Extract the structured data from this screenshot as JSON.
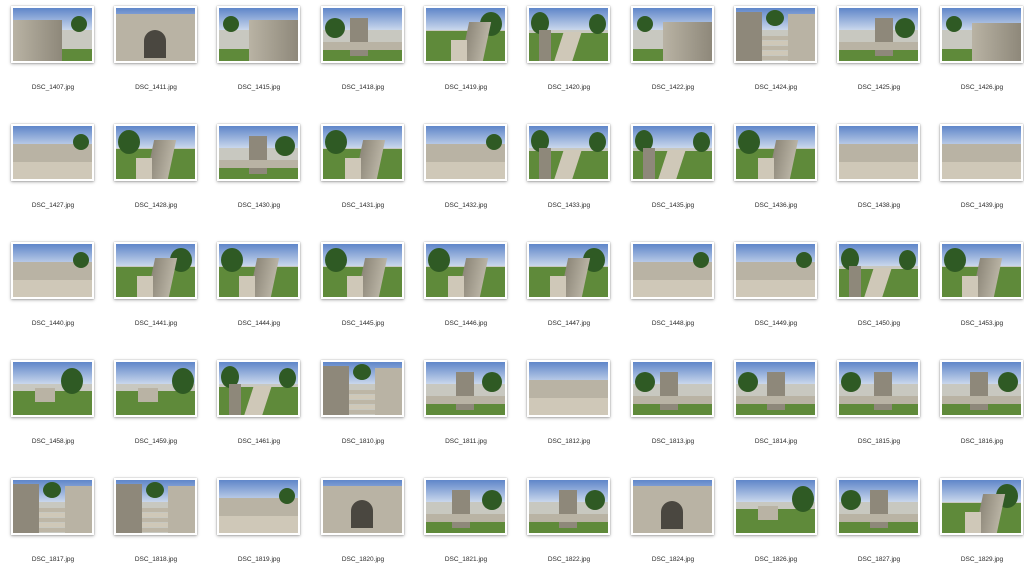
{
  "files": [
    "DSC_1407.jpg",
    "DSC_1411.jpg",
    "DSC_1415.jpg",
    "DSC_1418.jpg",
    "DSC_1419.jpg",
    "DSC_1420.jpg",
    "DSC_1422.jpg",
    "DSC_1424.jpg",
    "DSC_1425.jpg",
    "DSC_1426.jpg",
    "DSC_1427.jpg",
    "DSC_1428.jpg",
    "DSC_1430.jpg",
    "DSC_1431.jpg",
    "DSC_1432.jpg",
    "DSC_1433.jpg",
    "DSC_1435.jpg",
    "DSC_1436.jpg",
    "DSC_1438.jpg",
    "DSC_1439.jpg",
    "DSC_1440.jpg",
    "DSC_1441.jpg",
    "DSC_1444.jpg",
    "DSC_1445.jpg",
    "DSC_1446.jpg",
    "DSC_1447.jpg",
    "DSC_1448.jpg",
    "DSC_1449.jpg",
    "DSC_1450.jpg",
    "DSC_1453.jpg",
    "DSC_1458.jpg",
    "DSC_1459.jpg",
    "DSC_1461.jpg",
    "DSC_1810.jpg",
    "DSC_1811.jpg",
    "DSC_1812.jpg",
    "DSC_1813.jpg",
    "DSC_1814.jpg",
    "DSC_1815.jpg",
    "DSC_1816.jpg",
    "DSC_1817.jpg",
    "DSC_1818.jpg",
    "DSC_1819.jpg",
    "DSC_1820.jpg",
    "DSC_1821.jpg",
    "DSC_1822.jpg",
    "DSC_1824.jpg",
    "DSC_1826.jpg",
    "DSC_1827.jpg",
    "DSC_1829.jpg"
  ],
  "scenes": [
    "wallLeft",
    "gate",
    "wallRight",
    "tower",
    "rampart",
    "path",
    "wallRight",
    "stairs",
    "tower",
    "wallRight",
    "plaza",
    "rampart",
    "tower",
    "rampart",
    "plaza",
    "path",
    "path",
    "rampart",
    "plaza",
    "plaza",
    "plaza",
    "rampart",
    "rampart",
    "rampart",
    "rampart",
    "rampart",
    "plaza",
    "plaza",
    "path",
    "rampart",
    "field",
    "field",
    "path",
    "stairs",
    "tower",
    "plaza",
    "tower",
    "tower",
    "tower",
    "tower",
    "stairs",
    "stairs",
    "plaza",
    "gate",
    "tower",
    "tower",
    "gate",
    "field",
    "tower",
    "rampart"
  ],
  "colors": {
    "sky": "#5f86c9",
    "sky_light": "#c9d7ec",
    "stone": "#b9b3a4",
    "stone_dark": "#8e887a",
    "grass": "#5f8a3a",
    "tree": "#2f5a24",
    "path": "#cfc8b8"
  }
}
